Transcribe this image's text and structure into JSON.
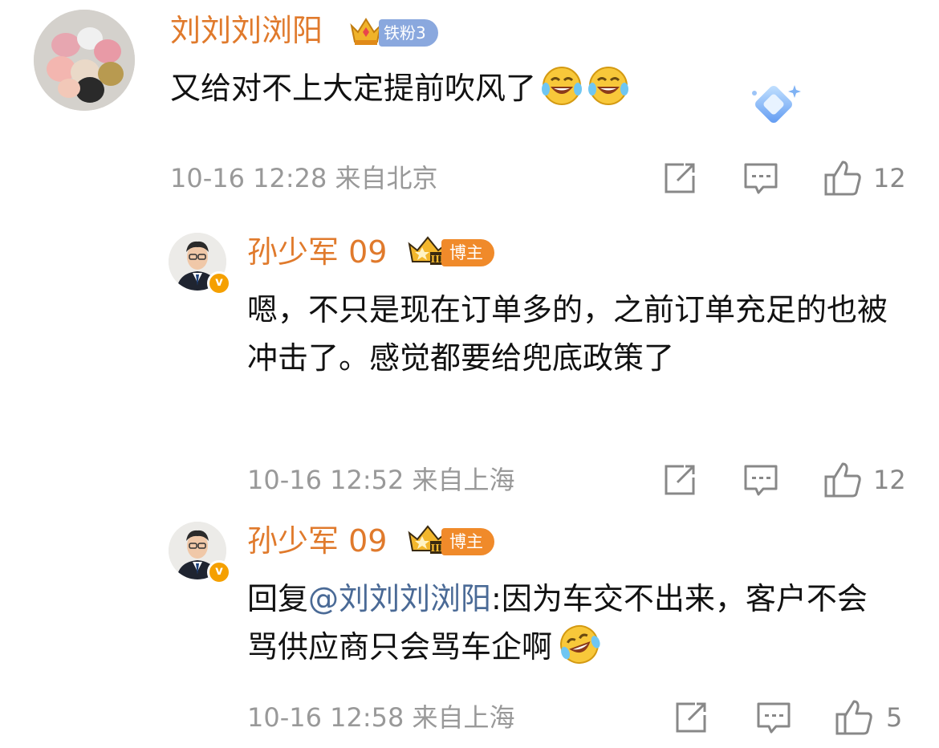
{
  "comment1": {
    "username": "刘刘刘浏阳",
    "fan_badge": "铁粉3",
    "text": "又给对不上大定提前吹风了",
    "time": "10-16 12:28",
    "location": "来自北京",
    "likes": "12"
  },
  "reply1": {
    "username": "孙少军 09",
    "role_badge": "博主",
    "text": "嗯，不只是现在订单多的，之前订单充足的也被冲击了。感觉都要给兜底政策了",
    "time": "10-16 12:52",
    "location": "来自上海",
    "likes": "12"
  },
  "reply2": {
    "username": "孙少军 09",
    "role_badge": "博主",
    "reply_prefix": "回复",
    "mention": "@刘刘刘浏阳",
    "text": ":因为车交不出来，客户不会骂供应商只会骂车企啊",
    "time": "10-16 12:58",
    "location": "来自上海",
    "likes": "5"
  },
  "colors": {
    "username": "#e07a2c",
    "mention": "#4a6a96",
    "meta": "#999999",
    "fan_badge": "#8aa8de",
    "blogger_badge": "#f08a2a",
    "verified": "#f5a000"
  },
  "icons": [
    "share-icon",
    "comment-icon",
    "like-icon",
    "crown-icon",
    "verified-icon",
    "laugh-cry-emoji"
  ]
}
